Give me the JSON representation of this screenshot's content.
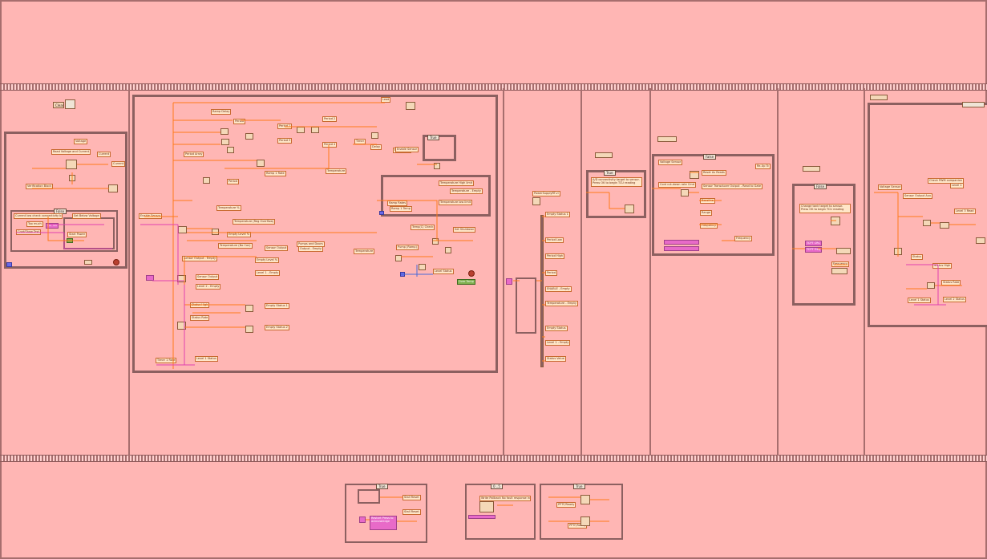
{
  "diagram": {
    "colors": {
      "background": "#ffb6b4",
      "frame": "#a76e6e",
      "wire_orange": "#ff7a1a",
      "wire_pink": "#e040b0",
      "wire_blue": "#4a6ad8"
    },
    "top_panel": {
      "label": ""
    },
    "frame1": {
      "clear_label": "Clear",
      "case_label": "False",
      "notes": [
        "Voltage",
        "Read Voltage and Current",
        "Current",
        "Current",
        "Verification Block",
        "Current low check connectivity b",
        "Too much",
        "Pot Set",
        "Set Below Voltage",
        "Cont/Show Text",
        "Start Power"
      ]
    },
    "frame2": {
      "labels": [
        "Lead",
        "Ramp Delay",
        "Period",
        "Period 1",
        "Period 2",
        "Period 3",
        "Period 4",
        "Timer",
        "Period Array",
        "Delay",
        "Period",
        "Temperature %",
        "Temperature (Reg Overflow)",
        "Empty Level %",
        "Temperature (No Cov)",
        "Ramp 1 Rate",
        "Temperature",
        "Sensor Output - Empty",
        "Empty Level %",
        "Level 1 - Empty",
        "Sensor Output",
        "Enable Sensor",
        "Level 2 - Empty",
        "Sensor Output",
        "Pumps and Doors",
        "Output - Empty",
        "Empty Status 1",
        "Empty Status 2",
        "Status High",
        "Status Rate",
        "Level 1 Status",
        "Timer 1 Rate",
        "Heat Cycle",
        "Temperature High limit",
        "Temperature - Empty",
        "Ramp Rates",
        "Ramp 1 Temp",
        "Temperature low limit",
        "Temp(C) Check",
        "Temperature",
        "Set Shutdown",
        "Level Status",
        "Over Temp",
        "Pump (Ramp)",
        "Enable Sensor"
      ],
      "case_label": "True"
    },
    "frame3": {
      "title": "PowerSupplyRT.vi",
      "outputs": [
        "Empty Status 1",
        "Period Low",
        "Period High",
        "Period",
        "ENABLE - Empty",
        "Temperature - Empty",
        "Empty Status",
        "Level 1 - Empty",
        "Status Value"
      ]
    },
    "frame4": {
      "case_label": "True",
      "message": "A/D connectivity target to sensor. Press OK to begin TCU reading"
    },
    "frame5": {
      "case_label": "False",
      "labels": [
        "Voltage Sensor",
        "Re-Up Tc",
        "Cont cut-down rate Cmd",
        "Reset As Reads",
        "Sensor Transducer Output - Read to Gate",
        "Baseline",
        "Frequency",
        "Range",
        "Frequency"
      ]
    },
    "frame6": {
      "case_label": "False",
      "message": "Change tank target to sensor. Press OK to begin TCU reading",
      "values": [
        "TCPT CRC",
        "TCPT Freq",
        "Frequency"
      ]
    },
    "frame7": {
      "labels": [
        "Voltage Sensor",
        "Sensor Output Aux",
        "Level 3 Read",
        "Level 1",
        "Status",
        "Status High",
        "Level 1 Status",
        "Level 2 Status",
        "Status Rate",
        "Check PWM companion"
      ]
    },
    "bottom": {
      "box1": {
        "case_label": "True",
        "labels": [
          "Stall Reset",
          "Stall Reset",
          "Restart Press to acknowledge"
        ]
      },
      "box2": {
        "case_label": "0 ..5",
        "labels": [
          "Write Pollback No fault response in"
        ]
      },
      "box3": {
        "case_label": "True",
        "labels": [
          "PPTF/Ready",
          "PPTF/Ready"
        ]
      }
    }
  }
}
